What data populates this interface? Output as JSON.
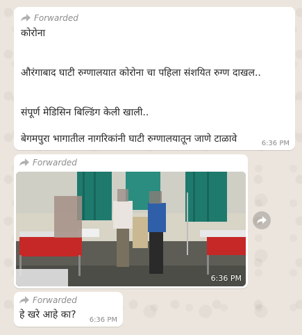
{
  "messages": [
    {
      "forwarded_label": "Forwarded",
      "lines": [
        "कोरोना",
        "औरंगाबाद घाटी रुग्णालयात कोरोना चा पहिला संशयित रुग्ण दाखल..",
        "संपूर्ण मेडिसिन बिल्डिंग केली खाली..",
        "बेगमपुरा भागातील नागरिकांनी घाटी रुग्णालयातून जाणे टाळावे"
      ],
      "time": "6:36 PM"
    },
    {
      "forwarded_label": "Forwarded",
      "image_desc": "photo",
      "time": "6:36 PM"
    },
    {
      "forwarded_label": "Forwarded",
      "text": "हे खरे आहे का?",
      "time": "6:36 PM"
    }
  ],
  "icons": {
    "forward": "forward-arrow-icon",
    "share": "share-arrow-icon"
  },
  "colors": {
    "bubble": "#ffffff",
    "meta_text": "#8c8c8c",
    "wallpaper": "#ece5dd"
  }
}
